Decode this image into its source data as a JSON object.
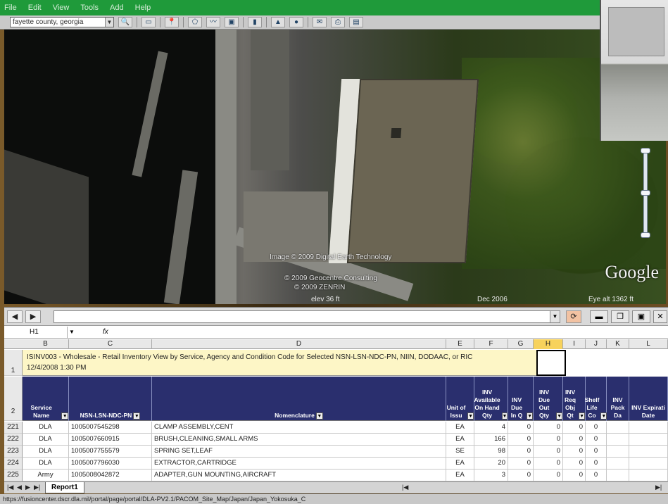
{
  "menu": [
    "File",
    "Edit",
    "View",
    "Tools",
    "Add",
    "Help"
  ],
  "search": {
    "value": "fayette county, georgia"
  },
  "map": {
    "credits": [
      "Image © 2009 Digital Earth Technology",
      "© 2009 Geocentre Consulting",
      "© 2009 ZENRIN"
    ],
    "elev": "elev   36 ft",
    "date": "Dec 2006",
    "eye_alt": "Eye alt   1362 ft",
    "google_logo": "Google"
  },
  "formula": {
    "cell_ref": "H1",
    "fx": "fx"
  },
  "columns": [
    {
      "label": "B",
      "selected": false
    },
    {
      "label": "C",
      "selected": false
    },
    {
      "label": "D",
      "selected": false
    },
    {
      "label": "E",
      "selected": false
    },
    {
      "label": "F",
      "selected": false
    },
    {
      "label": "G",
      "selected": false
    },
    {
      "label": "H",
      "selected": true
    },
    {
      "label": "I",
      "selected": false
    },
    {
      "label": "J",
      "selected": false
    },
    {
      "label": "K",
      "selected": false
    },
    {
      "label": "L",
      "selected": false
    }
  ],
  "report_title": {
    "line1": "ISINV003 - Wholesale - Retail Inventory View by Service, Agency and Condition Code for Selected NSN-LSN-NDC-PN, NIIN, DODAAC, or RIC",
    "line2": "12/4/2008 1:30 PM"
  },
  "header_row_number": "2",
  "title_row_number": "1",
  "headers": [
    "Service Name",
    "NSN-LSN-NDC-PN",
    "Nomenclature",
    "Unit of Issu",
    "INV Available On Hand Qty",
    "INV Due In Q",
    "INV Due Out Qty",
    "INV Req Obj Qt",
    "Shelf Life Co",
    "INV Pack Da",
    "INV Expirati Date"
  ],
  "rows": [
    {
      "num": "221",
      "service": "DLA",
      "nsn": "1005007545298",
      "nomen": "CLAMP ASSEMBLY,CENT",
      "unit": "EA",
      "onhand": "4",
      "duein": "0",
      "dueout": "0",
      "reqobj": "0",
      "shelf": "0"
    },
    {
      "num": "222",
      "service": "DLA",
      "nsn": "1005007660915",
      "nomen": "BRUSH,CLEANING,SMALL ARMS",
      "unit": "EA",
      "onhand": "166",
      "duein": "0",
      "dueout": "0",
      "reqobj": "0",
      "shelf": "0"
    },
    {
      "num": "223",
      "service": "DLA",
      "nsn": "1005007755579",
      "nomen": "SPRING SET,LEAF",
      "unit": "SE",
      "onhand": "98",
      "duein": "0",
      "dueout": "0",
      "reqobj": "0",
      "shelf": "0"
    },
    {
      "num": "224",
      "service": "DLA",
      "nsn": "1005007796030",
      "nomen": "EXTRACTOR,CARTRIDGE",
      "unit": "EA",
      "onhand": "20",
      "duein": "0",
      "dueout": "0",
      "reqobj": "0",
      "shelf": "0"
    },
    {
      "num": "225",
      "service": "Army",
      "nsn": "1005008042872",
      "nomen": "ADAPTER,GUN MOUNTING,AIRCRAFT",
      "unit": "EA",
      "onhand": "3",
      "duein": "0",
      "dueout": "0",
      "reqobj": "0",
      "shelf": "0"
    }
  ],
  "sheet_tab": "Report1",
  "status_url": "https://fusioncenter.dscr.dla.mil/portal/page/portal/DLA-PV2.1/PACOM_Site_Map/Japan/Japan_Yokosuka_C"
}
